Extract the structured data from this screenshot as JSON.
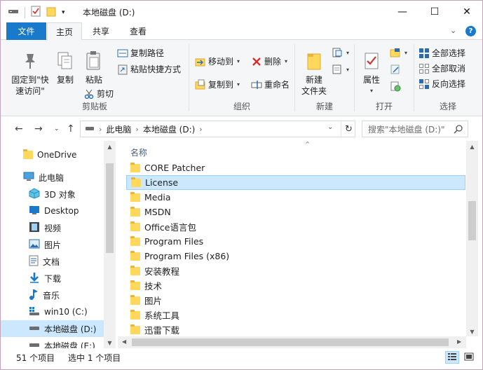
{
  "window": {
    "title": "本地磁盘 (D:)",
    "minimize_glyph": "—",
    "maximize_glyph": "☐",
    "close_glyph": "✕"
  },
  "tabs": {
    "file": "文件",
    "home": "主页",
    "share": "共享",
    "view": "查看",
    "ribbon_toggle": "⌄",
    "help": "?"
  },
  "ribbon": {
    "clipboard": {
      "label": "剪贴板",
      "pin_line1": "固定到\"快",
      "pin_line2": "速访问\"",
      "copy": "复制",
      "paste": "粘贴",
      "copy_path": "复制路径",
      "paste_shortcut": "粘贴快捷方式",
      "cut": "剪切"
    },
    "organize": {
      "label": "组织",
      "move_to": "移动到",
      "copy_to": "复制到",
      "delete": "删除",
      "rename": "重命名"
    },
    "new": {
      "label": "新建",
      "new_folder_line1": "新建",
      "new_folder_line2": "文件夹"
    },
    "open": {
      "label": "打开",
      "properties": "属性"
    },
    "select": {
      "label": "选择",
      "select_all": "全部选择",
      "select_none": "全部取消",
      "invert": "反向选择"
    }
  },
  "address": {
    "crumbs": [
      "此电脑",
      "本地磁盘 (D:)"
    ],
    "search_placeholder": "搜索\"本地磁盘 (D:)\""
  },
  "nav": {
    "items": [
      {
        "label": "OneDrive",
        "icon": "folder-icon"
      },
      {
        "label": "此电脑",
        "icon": "computer-icon"
      },
      {
        "label": "3D 对象",
        "icon": "cube-icon"
      },
      {
        "label": "Desktop",
        "icon": "desktop-icon"
      },
      {
        "label": "视频",
        "icon": "video-icon"
      },
      {
        "label": "图片",
        "icon": "picture-icon"
      },
      {
        "label": "文档",
        "icon": "document-icon"
      },
      {
        "label": "下载",
        "icon": "download-icon"
      },
      {
        "label": "音乐",
        "icon": "music-icon"
      },
      {
        "label": "win10 (C:)",
        "icon": "drive-icon"
      },
      {
        "label": "本地磁盘 (D:)",
        "icon": "drive-icon"
      },
      {
        "label": "本地磁盘 (E:)",
        "icon": "drive-icon"
      }
    ]
  },
  "files": {
    "column_name": "名称",
    "rows": [
      "CORE Patcher",
      "License",
      "Media",
      "MSDN",
      "Office语言包",
      "Program Files",
      "Program Files (x86)",
      "安装教程",
      "技术",
      "图片",
      "系统工具",
      "迅雷下载"
    ],
    "selected_index": 1
  },
  "status": {
    "count": "51 个项目",
    "selected": "选中 1 个项目"
  },
  "colors": {
    "accent": "#1979ca",
    "selection": "#cce8ff",
    "selection_border": "#99d1ff",
    "folder": "#ffd85c"
  }
}
